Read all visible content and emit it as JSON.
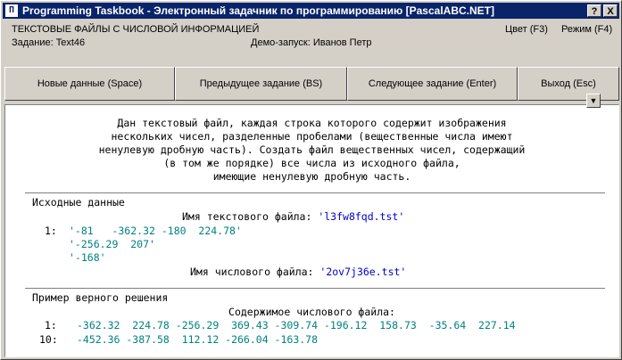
{
  "window": {
    "title": "Programming Taskbook - Электронный задачник по программированию [PascalABC.NET]",
    "help_label": "?",
    "close_label": "X"
  },
  "header": {
    "group": "ТЕКСТОВЫЕ ФАЙЛЫ С ЧИСЛОВОЙ ИНФОРМАЦИЕЙ",
    "task": "Задание: Text46",
    "demo": "Демо-запуск: Иванов Петр",
    "color_label": "Цвет (F3)",
    "mode_label": "Режим (F4)"
  },
  "toolbar": {
    "new_data": "Новые данные (Space)",
    "prev_task": "Предыдущее задание (BS)",
    "next_task": "Следующее задание (Enter)",
    "exit": "Выход (Esc)"
  },
  "task_text": [
    "Дан текстовый файл, каждая строка которого содержит изображения",
    "нескольких чисел, разделенные пробелами (вещественные числа имеют",
    "ненулевую дробную часть). Создать файл вещественных чисел, содержащий",
    "(в том же порядке) все числа из исходного файла,",
    "имеющие ненулевую дробную часть."
  ],
  "input_section": {
    "title": "Исходные данные",
    "text_file_label": "Имя текстового файла: ",
    "text_file_name": "'l3fw8fqd.tst'",
    "line_no": "1:",
    "lines": [
      "'-81   -362.32 -180  224.78'",
      "'-256.29  207'",
      "'-168'"
    ],
    "num_file_label": "Имя числового файла: ",
    "num_file_name": "'2ov7j36e.tst'"
  },
  "solution_section": {
    "title": "Пример верного решения",
    "content_label": "Содержимое числового файла:",
    "row1_no": "1:",
    "row1": "-362.32  224.78 -256.29  369.43 -309.74 -196.12  158.73  -35.64  227.14",
    "row2_no": "10:",
    "row2": "-452.36 -387.58  112.12 -266.04 -163.78"
  }
}
